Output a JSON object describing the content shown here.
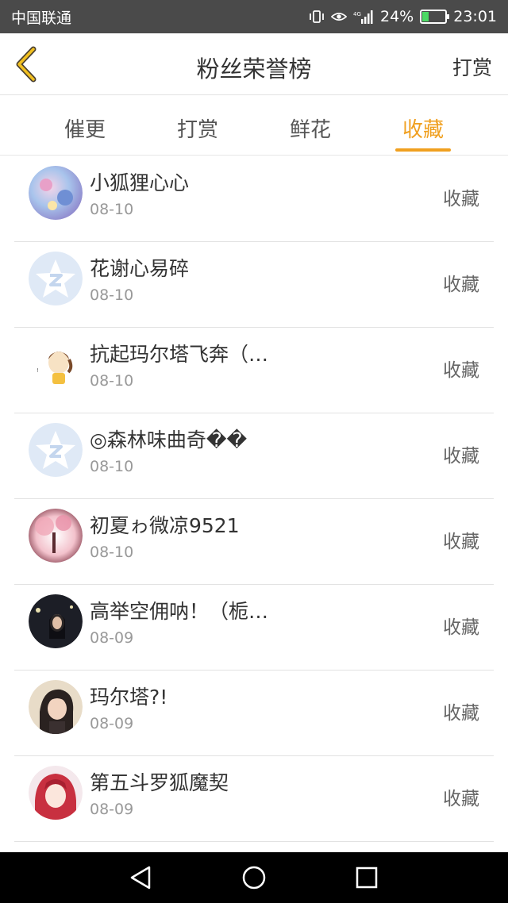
{
  "statusbar": {
    "carrier": "中国联通",
    "battery": "24%",
    "time": "23:01",
    "network": "4G"
  },
  "header": {
    "title": "粉丝荣誉榜",
    "right_action": "打赏"
  },
  "tabs": [
    {
      "label": "催更",
      "active": false
    },
    {
      "label": "打赏",
      "active": false
    },
    {
      "label": "鲜花",
      "active": false
    },
    {
      "label": "收藏",
      "active": true
    }
  ],
  "rows": [
    {
      "name": "小狐狸心心",
      "date": "08-10",
      "action": "收藏",
      "avatar": "colorful-illustration"
    },
    {
      "name": "花谢心易碎",
      "date": "08-10",
      "action": "收藏",
      "avatar": "default-star"
    },
    {
      "name": "抗起玛尔塔飞奔（…",
      "date": "08-10",
      "action": "收藏",
      "avatar": "cartoon-girl"
    },
    {
      "name": "◎森林味曲奇��",
      "date": "08-10",
      "action": "收藏",
      "avatar": "default-star"
    },
    {
      "name": "初夏ゎ微凉9521",
      "date": "08-10",
      "action": "收藏",
      "avatar": "pink-tree"
    },
    {
      "name": "高举空佣呐！（栀…",
      "date": "08-09",
      "action": "收藏",
      "avatar": "night-photo"
    },
    {
      "name": "玛尔塔?!",
      "date": "08-09",
      "action": "收藏",
      "avatar": "portrait-photo"
    },
    {
      "name": "第五斗罗狐魔契",
      "date": "08-09",
      "action": "收藏",
      "avatar": "anime-red"
    }
  ],
  "colors": {
    "accent": "#f0a020",
    "statusbar": "#4a4a4a",
    "default_avatar": "#dfe9f6"
  }
}
